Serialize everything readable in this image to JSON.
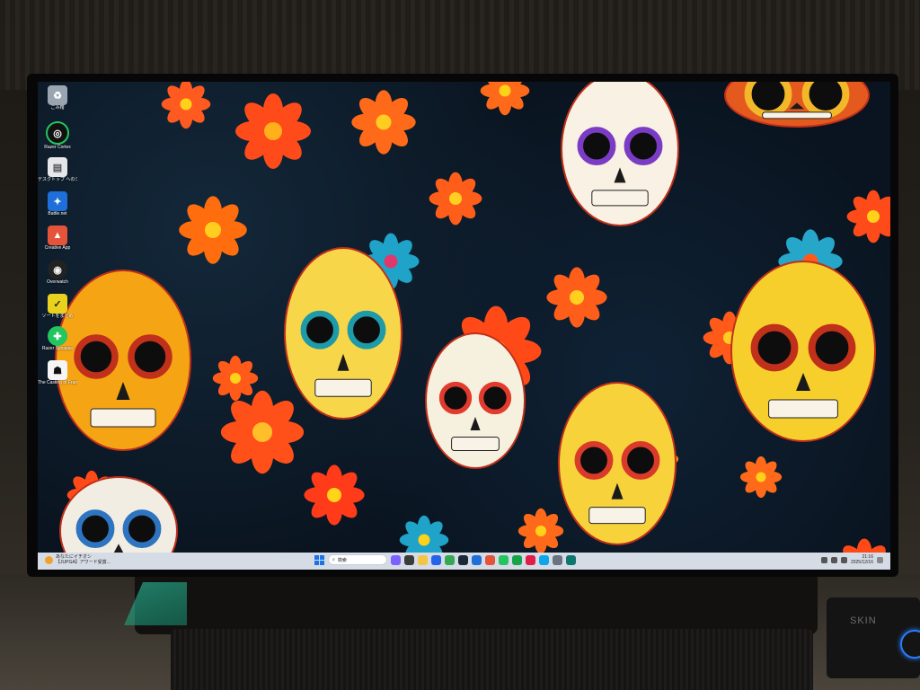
{
  "desktop": {
    "icons": [
      {
        "label": "ごみ箱",
        "icon": "recycle-bin-icon",
        "color": "#9aa5b1"
      },
      {
        "label": "Razer Cortex",
        "icon": "razer-cortex-icon",
        "color": "#22c55e"
      },
      {
        "label": "デスクトップ へのショートカット (OneDr...",
        "icon": "file-shortcut-icon",
        "color": "#e5e7eb"
      },
      {
        "label": "Battle.net",
        "icon": "battlenet-icon",
        "color": "#1e6fd9"
      },
      {
        "label": "Creative App",
        "icon": "creative-app-icon",
        "color": "#e5533a"
      },
      {
        "label": "Overwatch",
        "icon": "overwatch-icon",
        "color": "#f2f2f2"
      },
      {
        "label": "ソートをまとめ",
        "icon": "note-app-icon",
        "color": "#e8d21d"
      },
      {
        "label": "Razer Synapse",
        "icon": "razer-synapse-icon",
        "color": "#22c55e"
      },
      {
        "label": "The Casting of Frank Stone",
        "icon": "game-icon",
        "color": "#f5f5f5"
      }
    ]
  },
  "taskbar": {
    "news_line1": "あなたにイチオシ",
    "news_line2": "【JUPGA】アワード受賞...",
    "search_placeholder": "検索",
    "apps": [
      {
        "icon": "copilot-icon",
        "color": "#7b61ff"
      },
      {
        "icon": "task-view-icon",
        "color": "#3b3b3b"
      },
      {
        "icon": "file-explorer-icon",
        "color": "#f4c542"
      },
      {
        "icon": "store-icon",
        "color": "#2563eb"
      },
      {
        "icon": "chrome-icon",
        "color": "#34a853"
      },
      {
        "icon": "steam-icon",
        "color": "#1b2838"
      },
      {
        "icon": "battlenet-taskbar-icon",
        "color": "#1e6fd9"
      },
      {
        "icon": "creative-taskbar-icon",
        "color": "#e5533a"
      },
      {
        "icon": "razer-taskbar-icon",
        "color": "#22c55e"
      },
      {
        "icon": "razer-cortex-taskbar-icon",
        "color": "#16a34a"
      },
      {
        "icon": "vpn-icon",
        "color": "#e11d48"
      },
      {
        "icon": "photos-icon",
        "color": "#0ea5e9"
      },
      {
        "icon": "settings-icon",
        "color": "#6b7280"
      },
      {
        "icon": "terminal-icon",
        "color": "#0f766e"
      }
    ],
    "time": "21:16",
    "date": "2025/12/16"
  },
  "device": {
    "brand": "SKIN"
  },
  "colors": {
    "accent": "#1a73e8",
    "taskbar_bg": "#e6ecf5"
  }
}
